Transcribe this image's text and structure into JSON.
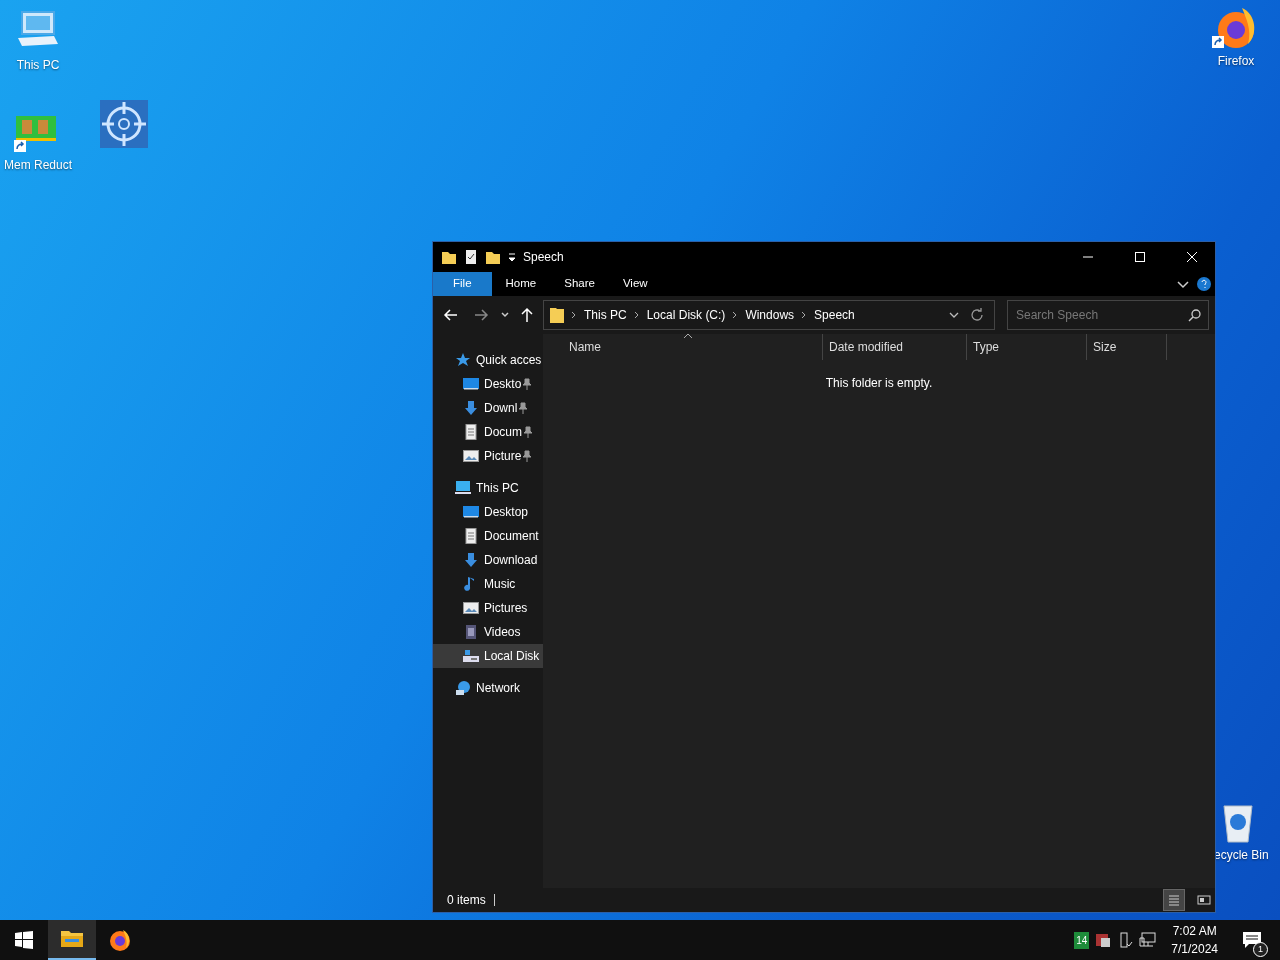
{
  "desktop_icons": [
    {
      "kind": "pc",
      "label": "This PC",
      "shortcut": false
    },
    {
      "kind": "ram",
      "label": "Mem Reduct",
      "shortcut": true
    },
    {
      "kind": "target",
      "shortcut": false
    },
    {
      "kind": "firefox",
      "label": "Firefox",
      "shortcut": true
    },
    {
      "kind": "recycle",
      "label": "ecycle Bin",
      "shortcut": false
    }
  ],
  "window": {
    "title": "Speech",
    "ribbon_tabs": [
      {
        "label": "File",
        "kind": "file"
      },
      {
        "label": "Home",
        "kind": "tab"
      },
      {
        "label": "Share",
        "kind": "tab"
      },
      {
        "label": "View",
        "kind": "tab"
      }
    ],
    "address": {
      "segments": [
        "This PC",
        "Local Disk (C:)",
        "Windows",
        "Speech"
      ]
    },
    "search": {
      "placeholder": "Search Speech"
    },
    "nav": [
      {
        "label": "Quick acces",
        "kind": "star",
        "selected": false,
        "children": [
          {
            "label": "Deskto",
            "kind": "desktop",
            "pinned": true,
            "selected": false
          },
          {
            "label": "Downl",
            "kind": "download",
            "pinned": true,
            "selected": false
          },
          {
            "label": "Docum",
            "kind": "document",
            "pinned": true,
            "selected": false
          },
          {
            "label": "Picture",
            "kind": "pictures",
            "pinned": true,
            "selected": false
          }
        ]
      },
      {
        "label": "This PC",
        "kind": "pc",
        "selected": false,
        "children": [
          {
            "label": "Desktop",
            "kind": "desktop",
            "pinned": false,
            "selected": false
          },
          {
            "label": "Document",
            "kind": "document",
            "pinned": false,
            "selected": false
          },
          {
            "label": "Download",
            "kind": "download",
            "pinned": false,
            "selected": false
          },
          {
            "label": "Music",
            "kind": "music",
            "pinned": false,
            "selected": false
          },
          {
            "label": "Pictures",
            "kind": "pictures",
            "pinned": false,
            "selected": false
          },
          {
            "label": "Videos",
            "kind": "videos",
            "pinned": false,
            "selected": false
          },
          {
            "label": "Local Disk",
            "kind": "disk",
            "pinned": false,
            "selected": true
          }
        ]
      },
      {
        "label": "Network",
        "kind": "network",
        "selected": false
      }
    ],
    "columns": [
      {
        "label": "Name",
        "sorted": true
      },
      {
        "label": "Date modified",
        "sorted": false
      },
      {
        "label": "Type",
        "sorted": false
      },
      {
        "label": "Size",
        "sorted": false
      }
    ],
    "empty_message": "This folder is empty.",
    "status": "0 items",
    "views": [
      {
        "kind": "details",
        "selected": true
      },
      {
        "kind": "tiles",
        "selected": false
      }
    ]
  },
  "taskbar": {
    "apps": [
      {
        "kind": "explorer",
        "active": true
      },
      {
        "kind": "firefox",
        "active": false
      }
    ],
    "tray_badge": "14",
    "time": "7:02 AM",
    "date": "7/1/2024",
    "notification_count": "1"
  }
}
